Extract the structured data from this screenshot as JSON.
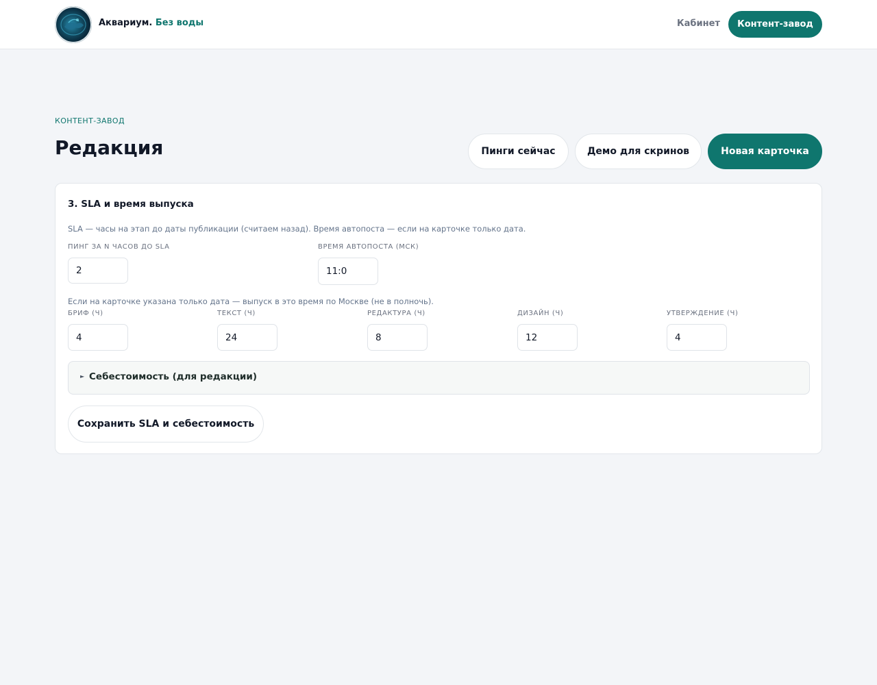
{
  "header": {
    "brand_name": "Аквариум.",
    "brand_tagline": "Без воды",
    "nav_link": "Кабинет",
    "nav_button": "Контент-завод",
    "logo_icon": "aquarium-logo-icon"
  },
  "page": {
    "eyebrow": "КОНТЕНТ-ЗАВОД",
    "title": "Редакция",
    "actions": {
      "pings_now": "Пинги сейчас",
      "demo": "Демо для скринов",
      "new_card": "Новая карточка"
    }
  },
  "colors": {
    "accent": "#0f766e",
    "background": "#f3f5f8"
  },
  "sla": {
    "title": "3. SLA и время выпуска",
    "description": "SLA — часы на этап до даты публикации (считаем назад). Время автопоста — если на карточке только дата.",
    "ping": {
      "label": "ПИНГ ЗА N ЧАСОВ ДО SLA",
      "value": "2"
    },
    "autopost": {
      "label": "ВРЕМЯ АВТОПОСТА (МСК)",
      "value": "11:0"
    },
    "date_hint": "Если на карточке указана только дата — выпуск в это время по Москве (не в полночь).",
    "stages": [
      {
        "label": "БРИФ (Ч)",
        "value": "4"
      },
      {
        "label": "ТЕКСТ (Ч)",
        "value": "24"
      },
      {
        "label": "РЕДАКТУРА (Ч)",
        "value": "8"
      },
      {
        "label": "ДИЗАЙН (Ч)",
        "value": "12"
      },
      {
        "label": "УТВЕРЖДЕНИЕ (Ч)",
        "value": "4"
      }
    ],
    "cost_summary": "Себестоимость (для редакции)",
    "cost_toggle_icon": "triangle-right-icon",
    "save_button": "Сохранить SLA и себестоимость"
  }
}
